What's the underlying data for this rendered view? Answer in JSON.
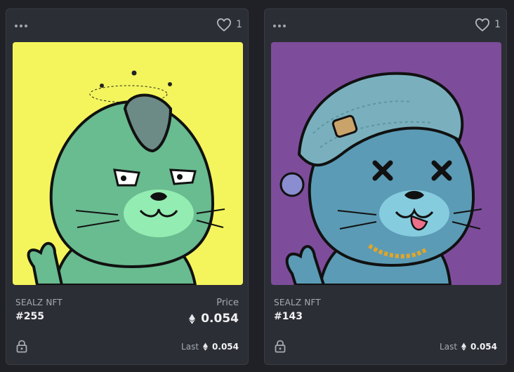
{
  "cards": [
    {
      "collection": "SEALZ NFT",
      "token": "#255",
      "likes": "1",
      "price_label": "Price",
      "price": "0.054",
      "last_label": "Last",
      "last_price": "0.054",
      "background": "#f4f55c"
    },
    {
      "collection": "SEALZ NFT",
      "token": "#143",
      "likes": "1",
      "last_label": "Last",
      "last_price": "0.054",
      "background": "#7d4d9b"
    }
  ]
}
